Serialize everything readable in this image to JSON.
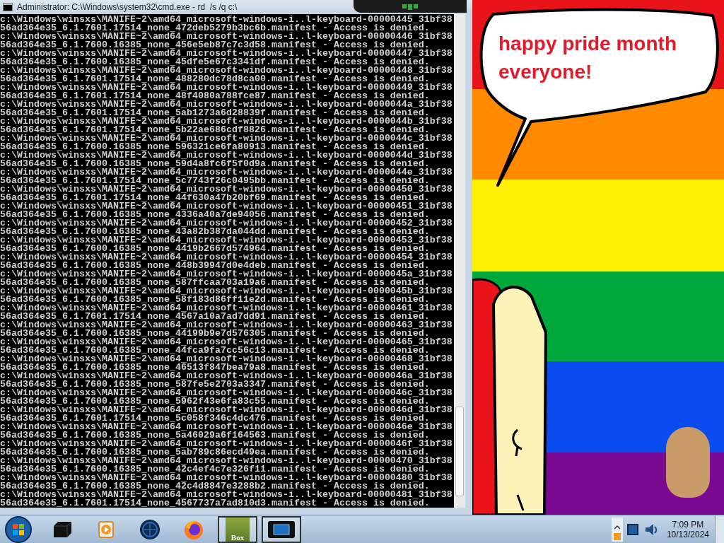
{
  "console_window": {
    "title": "Administrator: C:\\Windows\\system32\\cmd.exe - rd  /s /q c:\\",
    "lines": [
      "c:\\Windows\\winsxs\\MANIFE~2\\amd64_microsoft-windows-i..l-keyboard-00000445_31bf38",
      "56ad364e35_6.1.7601.17514_none_472deb5279b3bc6b.manifest - Access is denied.",
      "c:\\Windows\\winsxs\\MANIFE~2\\amd64_microsoft-windows-i..l-keyboard-00000446_31bf38",
      "56ad364e35_6.1.7600.16385_none_456e5eb87c7c3d58.manifest - Access is denied.",
      "c:\\Windows\\winsxs\\MANIFE~2\\amd64_microsoft-windows-i..l-keyboard-00000447_31bf38",
      "56ad364e35_6.1.7600.16385_none_45dfe5e67c3341df.manifest - Access is denied.",
      "c:\\Windows\\winsxs\\MANIFE~2\\amd64_microsoft-windows-i..l-keyboard-00000448_31bf38",
      "56ad364e35_6.1.7601.17514_none_488280dc78d8ca00.manifest - Access is denied.",
      "c:\\Windows\\winsxs\\MANIFE~2\\amd64_microsoft-windows-i..l-keyboard-00000449_31bf38",
      "56ad364e35_6.1.7601.17514_none_48f4080a788fce87.manifest - Access is denied.",
      "c:\\Windows\\winsxs\\MANIFE~2\\amd64_microsoft-windows-i..l-keyboard-0000044a_31bf38",
      "56ad364e35_6.1.7601.17514_none_5ab1273a6d28839f.manifest - Access is denied.",
      "c:\\Windows\\winsxs\\MANIFE~2\\amd64_microsoft-windows-i..l-keyboard-0000044b_31bf38",
      "56ad364e35_6.1.7601.17514_none_5b22ae686cdf8826.manifest - Access is denied.",
      "c:\\Windows\\winsxs\\MANIFE~2\\amd64_microsoft-windows-i..l-keyboard-0000044c_31bf38",
      "56ad364e35_6.1.7600.16385_none_596321ce6fa80913.manifest - Access is denied.",
      "c:\\Windows\\winsxs\\MANIFE~2\\amd64_microsoft-windows-i..l-keyboard-0000044d_31bf38",
      "56ad364e35_6.1.7600.16385_none_59d4a8fc6f5f0d9a.manifest - Access is denied.",
      "c:\\Windows\\winsxs\\MANIFE~2\\amd64_microsoft-windows-i..l-keyboard-0000044e_31bf38",
      "56ad364e35_6.1.7601.17514_none_5c7743f26c0495bb.manifest - Access is denied.",
      "c:\\Windows\\winsxs\\MANIFE~2\\amd64_microsoft-windows-i..l-keyboard-00000450_31bf38",
      "56ad364e35_6.1.7601.17514_none_44f630a47b20bf69.manifest - Access is denied.",
      "c:\\Windows\\winsxs\\MANIFE~2\\amd64_microsoft-windows-i..l-keyboard-00000451_31bf38",
      "56ad364e35_6.1.7600.16385_none_4336a40a7de94056.manifest - Access is denied.",
      "c:\\Windows\\winsxs\\MANIFE~2\\amd64_microsoft-windows-i..l-keyboard-00000452_31bf38",
      "56ad364e35_6.1.7600.16385_none_43a82b387da044dd.manifest - Access is denied.",
      "c:\\Windows\\winsxs\\MANIFE~2\\amd64_microsoft-windows-i..l-keyboard-00000453_31bf38",
      "56ad364e35_6.1.7600.16385_none_4419b2667d574964.manifest - Access is denied.",
      "c:\\Windows\\winsxs\\MANIFE~2\\amd64_microsoft-windows-i..l-keyboard-00000454_31bf38",
      "56ad364e35_6.1.7600.16385_none_448b39947d0e4deb.manifest - Access is denied.",
      "c:\\Windows\\winsxs\\MANIFE~2\\amd64_microsoft-windows-i..l-keyboard-0000045a_31bf38",
      "56ad364e35_6.1.7600.16385_none_587ffcaa703a19a6.manifest - Access is denied.",
      "c:\\Windows\\winsxs\\MANIFE~2\\amd64_microsoft-windows-i..l-keyboard-0000045b_31bf38",
      "56ad364e35_6.1.7600.16385_none_58f183d86ff11e2d.manifest - Access is denied.",
      "c:\\Windows\\winsxs\\MANIFE~2\\amd64_microsoft-windows-i..l-keyboard-00000461_31bf38",
      "56ad364e35_6.1.7601.17514_none_4567a10a7ad7dd91.manifest - Access is denied.",
      "c:\\Windows\\winsxs\\MANIFE~2\\amd64_microsoft-windows-i..l-keyboard-00000463_31bf38",
      "56ad364e35_6.1.7600.16385_none_44199b9e7d576305.manifest - Access is denied.",
      "c:\\Windows\\winsxs\\MANIFE~2\\amd64_microsoft-windows-i..l-keyboard-00000465_31bf38",
      "56ad364e35_6.1.7600.16385_none_44fca9fa7cc56c13.manifest - Access is denied.",
      "c:\\Windows\\winsxs\\MANIFE~2\\amd64_microsoft-windows-i..l-keyboard-00000468_31bf38",
      "56ad364e35_6.1.7600.16385_none_46513f847bea79a8.manifest - Access is denied.",
      "c:\\Windows\\winsxs\\MANIFE~2\\amd64_microsoft-windows-i..l-keyboard-0000046a_31bf38",
      "56ad364e35_6.1.7600.16385_none_587fe5e2703a3347.manifest - Access is denied.",
      "c:\\Windows\\winsxs\\MANIFE~2\\amd64_microsoft-windows-i..l-keyboard-0000046c_31bf38",
      "56ad364e35_6.1.7600.16385_none_5962f43e6fa83c55.manifest - Access is denied.",
      "c:\\Windows\\winsxs\\MANIFE~2\\amd64_microsoft-windows-i..l-keyboard-0000046d_31bf38",
      "56ad364e35_6.1.7601.17514_none_5c058f346c4dc476.manifest - Access is denied.",
      "c:\\Windows\\winsxs\\MANIFE~2\\amd64_microsoft-windows-i..l-keyboard-0000046e_31bf38",
      "56ad364e35_6.1.7600.16385_none_5a46029a6f164563.manifest - Access is denied.",
      "c:\\Windows\\winsxs\\MANIFE~2\\amd64_microsoft-windows-i..l-keyboard-0000046f_31bf38",
      "56ad364e35_6.1.7600.16385_none_5ab789c86ecd49ea.manifest - Access is denied.",
      "c:\\Windows\\winsxs\\MANIFE~2\\amd64_microsoft-windows-i..l-keyboard-00000470_31bf38",
      "56ad364e35_6.1.7600.16385_none_42c4ef4c7e326f11.manifest - Access is denied.",
      "c:\\Windows\\winsxs\\MANIFE~2\\amd64_microsoft-windows-i..l-keyboard-00000480_31bf38",
      "56ad364e35_6.1.7600.16385_none_42c4d8847e3288b2.manifest - Access is denied.",
      "c:\\Windows\\winsxs\\MANIFE~2\\amd64_microsoft-windows-i..l-keyboard-00000481_31bf38",
      "56ad364e35_6.1.7601.17514_none_4567737a7ad810d3.manifest - Access is denied."
    ]
  },
  "wallpaper": {
    "speech_bubble": "happy pride month everyone!"
  },
  "taskbar": {
    "items": [
      {
        "running": false
      },
      {
        "running": false
      },
      {
        "running": false
      },
      {
        "running": false
      },
      {
        "label": "Box",
        "running": true
      },
      {
        "running": true
      }
    ],
    "clock": {
      "time": "7:09 PM",
      "date": "10/13/2024"
    }
  }
}
